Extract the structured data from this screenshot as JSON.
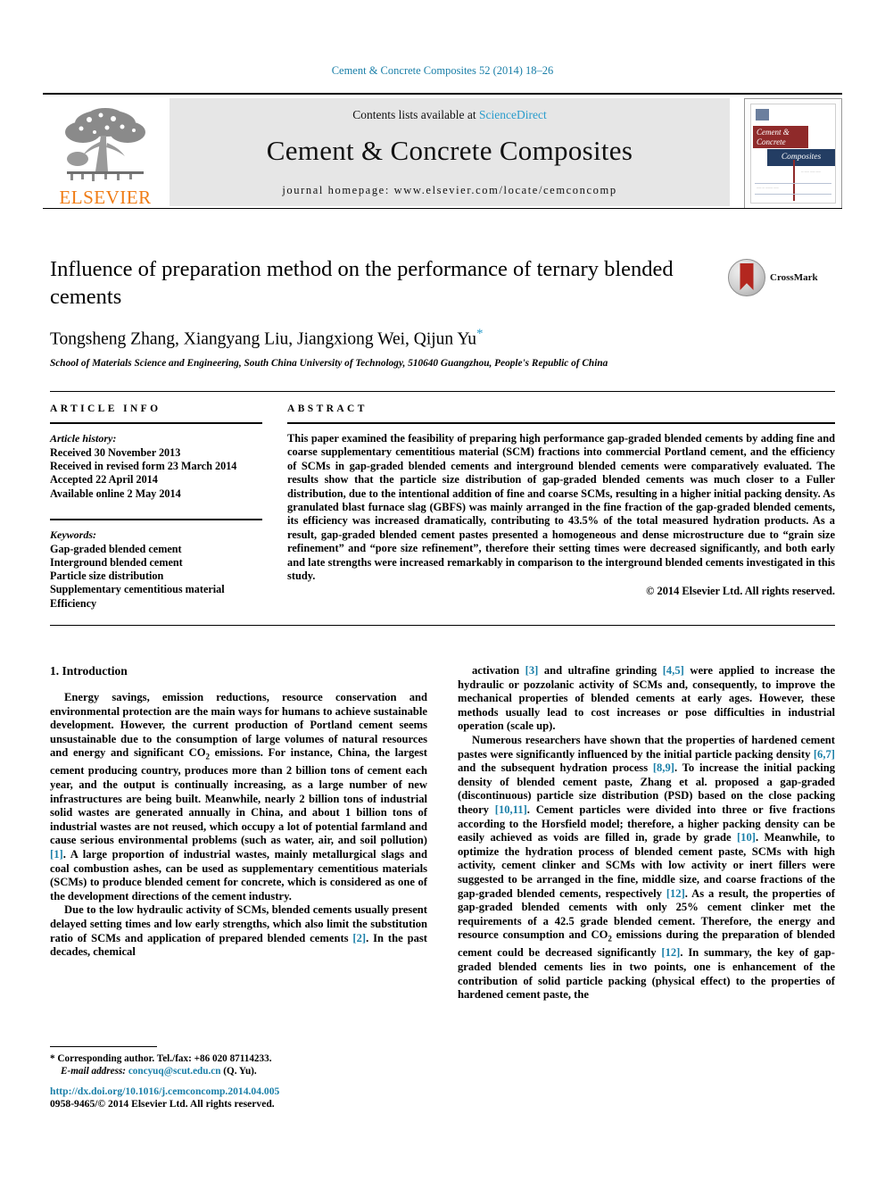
{
  "running_head": "Cement & Concrete Composites 52 (2014) 18–26",
  "masthead": {
    "contents_prefix": "Contents lists available at ",
    "sciencedirect": "ScienceDirect",
    "journal_title": "Cement & Concrete Composites",
    "homepage": "journal homepage: www.elsevier.com/locate/cemconcomp",
    "publisher_logo_text": "ELSEVIER",
    "cover": {
      "line1": "Cement &",
      "line2": "Concrete",
      "line3": "Composites"
    }
  },
  "article": {
    "title": "Influence of preparation method on the performance of ternary blended cements",
    "crossmark_label": "CrossMark",
    "authors": "Tongsheng Zhang, Xiangyang Liu, Jiangxiong Wei, Qijun Yu",
    "corresponding_marker": "*",
    "affiliation": "School of Materials Science and Engineering, South China University of Technology, 510640 Guangzhou, People's Republic of China"
  },
  "article_info": {
    "heading": "ARTICLE INFO",
    "history_label": "Article history:",
    "history": [
      "Received 30 November 2013",
      "Received in revised form 23 March 2014",
      "Accepted 22 April 2014",
      "Available online 2 May 2014"
    ],
    "keywords_label": "Keywords:",
    "keywords": [
      "Gap-graded blended cement",
      "Interground blended cement",
      "Particle size distribution",
      "Supplementary cementitious material",
      "Efficiency"
    ]
  },
  "abstract": {
    "heading": "ABSTRACT",
    "text": "This paper examined the feasibility of preparing high performance gap-graded blended cements by adding fine and coarse supplementary cementitious material (SCM) fractions into commercial Portland cement, and the efficiency of SCMs in gap-graded blended cements and interground blended cements were comparatively evaluated. The results show that the particle size distribution of gap-graded blended cements was much closer to a Fuller distribution, due to the intentional addition of fine and coarse SCMs, resulting in a higher initial packing density. As granulated blast furnace slag (GBFS) was mainly arranged in the fine fraction of the gap-graded blended cements, its efficiency was increased dramatically, contributing to 43.5% of the total measured hydration products. As a result, gap-graded blended cement pastes presented a homogeneous and dense microstructure due to “grain size refinement” and “pore size refinement”, therefore their setting times were decreased significantly, and both early and late strengths were increased remarkably in comparison to the interground blended cements investigated in this study.",
    "copyright": "© 2014 Elsevier Ltd. All rights reserved."
  },
  "body": {
    "section_heading": "1. Introduction",
    "left_paragraphs": [
      "Energy savings, emission reductions, resource conservation and environmental protection are the main ways for humans to achieve sustainable development. However, the current production of Portland cement seems unsustainable due to the consumption of large volumes of natural resources and energy and significant CO2 emissions. For instance, China, the largest cement producing country, produces more than 2 billion tons of cement each year, and the output is continually increasing, as a large number of new infrastructures are being built. Meanwhile, nearly 2 billion tons of industrial solid wastes are generated annually in China, and about 1 billion tons of industrial wastes are not reused, which occupy a lot of potential farmland and cause serious environmental problems (such as water, air, and soil pollution) [1]. A large proportion of industrial wastes, mainly metallurgical slags and coal combustion ashes, can be used as supplementary cementitious materials (SCMs) to produce blended cement for concrete, which is considered as one of the development directions of the cement industry.",
      "Due to the low hydraulic activity of SCMs, blended cements usually present delayed setting times and low early strengths, which also limit the substitution ratio of SCMs and application of prepared blended cements [2]. In the past decades, chemical"
    ],
    "right_paragraphs": [
      "activation [3] and ultrafine grinding [4,5] were applied to increase the hydraulic or pozzolanic activity of SCMs and, consequently, to improve the mechanical properties of blended cements at early ages. However, these methods usually lead to cost increases or pose difficulties in industrial operation (scale up).",
      "Numerous researchers have shown that the properties of hardened cement pastes were significantly influenced by the initial particle packing density [6,7] and the subsequent hydration process [8,9]. To increase the initial packing density of blended cement paste, Zhang et al. proposed a gap-graded (discontinuous) particle size distribution (PSD) based on the close packing theory [10,11]. Cement particles were divided into three or five fractions according to the Horsfield model; therefore, a higher packing density can be easily achieved as voids are filled in, grade by grade [10]. Meanwhile, to optimize the hydration process of blended cement paste, SCMs with high activity, cement clinker and SCMs with low activity or inert fillers were suggested to be arranged in the fine, middle size, and coarse fractions of the gap-graded blended cements, respectively [12]. As a result, the properties of gap-graded blended cements with only 25% cement clinker met the requirements of a 42.5 grade blended cement. Therefore, the energy and resource consumption and CO2 emissions during the preparation of blended cement could be decreased significantly [12]. In summary, the key of gap-graded blended cements lies in two points, one is enhancement of the contribution of solid particle packing (physical effect) to the properties of hardened cement paste, the"
    ]
  },
  "footnote": {
    "corresponding": "* Corresponding author. Tel./fax: +86 020 87114233.",
    "email_label": "E-mail address:",
    "email": "concyuq@scut.edu.cn",
    "email_suffix": "(Q. Yu)."
  },
  "footer": {
    "doi": "http://dx.doi.org/10.1016/j.cemconcomp.2014.04.005",
    "issn_line": "0958-9465/© 2014 Elsevier Ltd. All rights reserved."
  },
  "colors": {
    "link": "#1a7fa8",
    "sciencedirect": "#2a9ccc",
    "elsevier_orange": "#f07c14",
    "cover_red": "#8f2a2a",
    "cover_blue": "#233d63"
  }
}
